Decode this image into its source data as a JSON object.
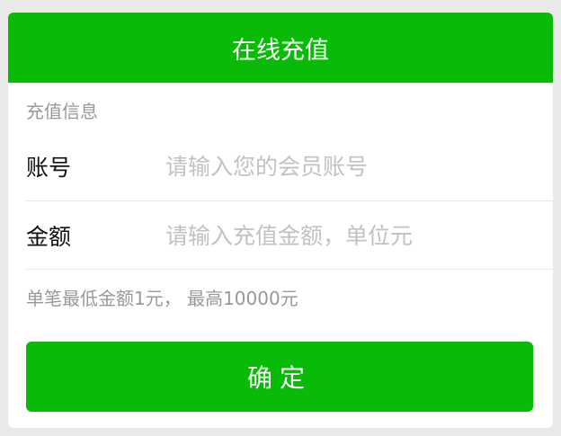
{
  "header": {
    "title": "在线充值"
  },
  "form": {
    "section_title": "充值信息",
    "account": {
      "label": "账号",
      "placeholder": "请输入您的会员账号",
      "value": ""
    },
    "amount": {
      "label": "金额",
      "placeholder": "请输入充值金额，单位元",
      "value": ""
    },
    "tip": "单笔最低金额1元， 最高10000元"
  },
  "actions": {
    "confirm_label": "确定"
  },
  "colors": {
    "brand_green": "#09bb07",
    "placeholder_gray": "#c2c2c2",
    "hint_gray": "#999999"
  }
}
